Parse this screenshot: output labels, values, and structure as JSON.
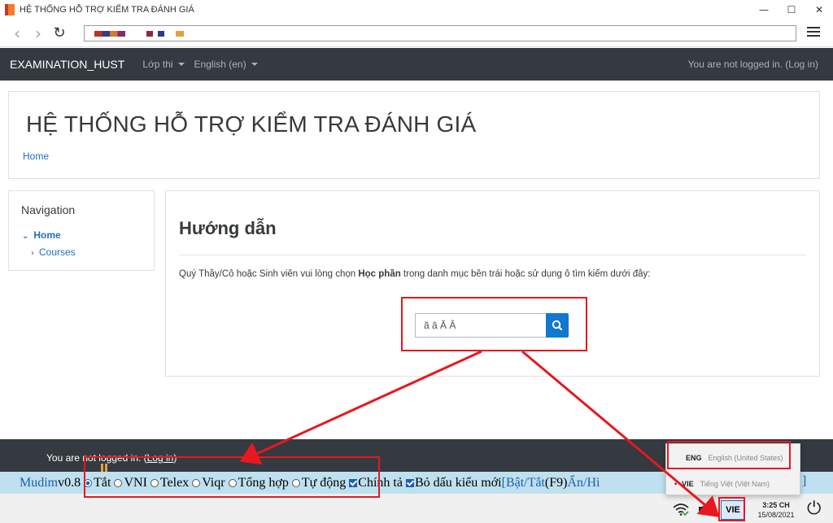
{
  "window": {
    "title": "HỆ THỐNG HỖ TRỢ KIỂM TRA ĐÁNH GIÁ",
    "minimize": "—",
    "maximize": "☐",
    "close": "✕"
  },
  "browser": {
    "back": "‹",
    "forward": "›",
    "reload": "↻"
  },
  "navbar": {
    "brand": "EXAMINATION_HUST",
    "menu1": "Lớp thi",
    "menu2": "English (en)",
    "login": "You are not logged in. (Log in)"
  },
  "header": {
    "title": "HỆ THỐNG HỖ TRỢ KIỂM TRA ĐÁNH GIÁ",
    "breadcrumb": "Home"
  },
  "navigation": {
    "title": "Navigation",
    "home": "Home",
    "courses": "Courses"
  },
  "main": {
    "title": "Hướng dẫn",
    "para_prefix": "Quý Thầy/Cô hoặc Sinh viên vui lòng chọn ",
    "para_bold": "Học phần",
    "para_suffix": " trong danh mục bên trái hoặc sử dụng ô tìm kiếm dưới đây:",
    "search_value": "ă â Ă Â"
  },
  "footer": {
    "prefix": "You are not logged in. (",
    "link": "Log in",
    "suffix": ")"
  },
  "mudim": {
    "name": "Mudim",
    "version": " v0.8",
    "opt_off": "Tắt",
    "opt_vni": " VNI",
    "opt_telex": " Telex",
    "opt_viqr": " Viqr",
    "opt_combo": " Tổng hợp",
    "opt_auto": " Tự động",
    "spell": "Chính tả",
    "newstyle": "Bỏ dấu kiểu mới",
    "bracket_open": " [ ",
    "toggle": "Bật/Tắt",
    "toggle_key": " (F9) ",
    "hide": "Ẩn/Hi",
    "bracket_close": "]"
  },
  "language_popup": {
    "eng_code": "ENG",
    "eng_name": "English (United States)",
    "vie_code": "VIE",
    "vie_name": "Tiếng Việt (Việt Nam)"
  },
  "taskbar": {
    "ime": "VIE",
    "time": "3:25 CH",
    "date": "15/08/2021"
  },
  "colors": {
    "navbar_bg": "#343a40",
    "link": "#1e6fc0",
    "search_button": "#1177d1",
    "mudim_bg": "#bfe0ee",
    "annotation": "#e8181e"
  }
}
